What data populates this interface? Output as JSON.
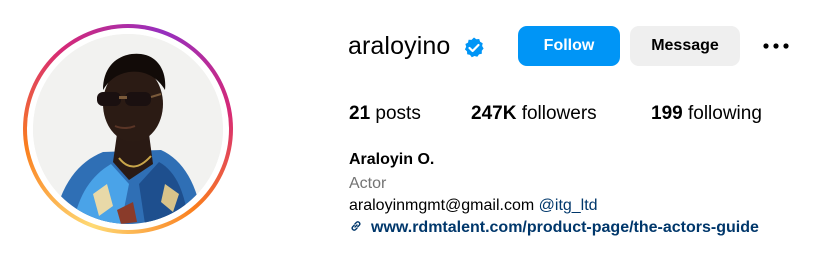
{
  "profile": {
    "username": "araloyino",
    "verified": true,
    "follow_label": "Follow",
    "message_label": "Message",
    "more_icon": "more-horizontal-icon"
  },
  "stats": {
    "posts_count": "21",
    "posts_label": " posts",
    "followers_count": "247K",
    "followers_label": " followers",
    "following_count": "199",
    "following_label": " following"
  },
  "bio": {
    "full_name": "Araloyin O.",
    "category": "Actor",
    "email": "araloyinmgmt@gmail.com",
    "mention": "@itg_ltd",
    "link_icon": "link-icon",
    "link_text": "www.rdmtalent.com/product-page/the-actors-guide"
  },
  "colors": {
    "accent_blue": "#0095f6",
    "link_blue": "#00376b",
    "secondary_text": "#737373",
    "message_button_bg": "#efefef"
  }
}
